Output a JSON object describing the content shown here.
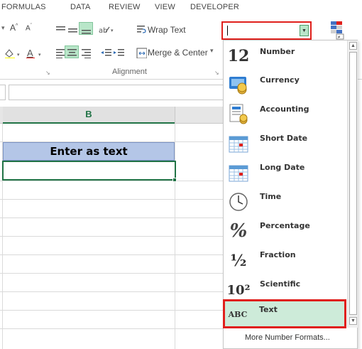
{
  "ribbon_tabs": [
    "FORMULAS",
    "DATA",
    "REVIEW",
    "VIEW",
    "DEVELOPER"
  ],
  "ribbon": {
    "wrap_text_label": "Wrap Text",
    "merge_center_label": "Merge & Center",
    "merge_arrow": "▾",
    "alignment_group_label": "Alignment",
    "font_size_up": "A",
    "font_size_down": "A",
    "launcher_glyph": "↘"
  },
  "sheet": {
    "column_header": "B",
    "header_cell_text": "Enter as text",
    "active_cell_value": ""
  },
  "number_format": {
    "current_value": "",
    "options": [
      {
        "label": "Number",
        "icon": "number-12-icon",
        "glyph": "12"
      },
      {
        "label": "Currency",
        "icon": "currency-icon",
        "glyph": ""
      },
      {
        "label": "Accounting",
        "icon": "accounting-icon",
        "glyph": ""
      },
      {
        "label": "Short Date",
        "icon": "calendar-icon",
        "glyph": ""
      },
      {
        "label": "Long Date",
        "icon": "calendar-icon",
        "glyph": ""
      },
      {
        "label": "Time",
        "icon": "clock-icon",
        "glyph": ""
      },
      {
        "label": "Percentage",
        "icon": "percent-icon",
        "glyph": "%"
      },
      {
        "label": "Fraction",
        "icon": "fraction-icon",
        "glyph": "½"
      },
      {
        "label": "Scientific",
        "icon": "scientific-icon",
        "glyph": "10²"
      },
      {
        "label": "Text",
        "icon": "abc-icon",
        "glyph": "ABC"
      }
    ],
    "more_formats_label": "More Number Formats..."
  },
  "colors": {
    "excel_green": "#217346",
    "highlight_red": "#e0201c",
    "header_cell_fill": "#b4c6e7",
    "selected_item_fill": "#cdebd9"
  }
}
